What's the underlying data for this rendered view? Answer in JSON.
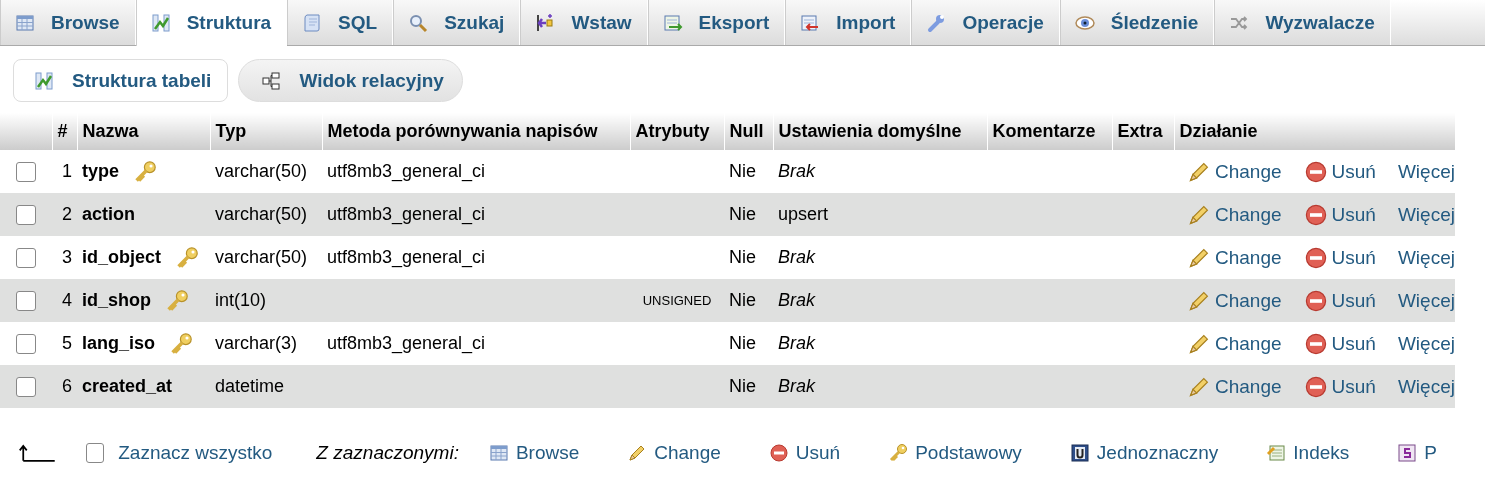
{
  "tabs": [
    {
      "label": "Browse",
      "kind": "table",
      "selected": false
    },
    {
      "label": "Struktura",
      "kind": "structure",
      "selected": true
    },
    {
      "label": "SQL",
      "kind": "scroll",
      "selected": false
    },
    {
      "label": "Szukaj",
      "kind": "search",
      "selected": false
    },
    {
      "label": "Wstaw",
      "kind": "insert",
      "selected": false
    },
    {
      "label": "Eksport",
      "kind": "export",
      "selected": false
    },
    {
      "label": "Import",
      "kind": "import",
      "selected": false
    },
    {
      "label": "Operacje",
      "kind": "wrench",
      "selected": false
    },
    {
      "label": "Śledzenie",
      "kind": "eye",
      "selected": false
    },
    {
      "label": "Wyzwalacze",
      "kind": "shuffle",
      "selected": false
    }
  ],
  "subtabs": [
    {
      "label": "Struktura tabeli",
      "kind": "structure",
      "selected": true
    },
    {
      "label": "Widok relacyjny",
      "kind": "relation",
      "selected": false
    }
  ],
  "table": {
    "columns": [
      "#",
      "Nazwa",
      "Typ",
      "Metoda porównywania napisów",
      "Atrybuty",
      "Null",
      "Ustawienia domyślne",
      "Komentarze",
      "Extra",
      "Działanie"
    ],
    "rows": [
      {
        "checked": false,
        "number": "1",
        "name": "type",
        "indexed": true,
        "type": "varchar(50)",
        "collation": "utf8mb3_general_ci",
        "null": "Nie",
        "default": "Brak",
        "default_is_null": true,
        "actions": [
          "Change",
          "Usuń",
          "Więcej"
        ]
      },
      {
        "checked": false,
        "number": "2",
        "name": "action",
        "indexed": false,
        "type": "varchar(50)",
        "collation": "utf8mb3_general_ci",
        "null": "Nie",
        "default": "upsert",
        "default_is_null": false,
        "actions": [
          "Change",
          "Usuń",
          "Więcej"
        ]
      },
      {
        "checked": false,
        "number": "3",
        "name": "id_object",
        "indexed": true,
        "type": "varchar(50)",
        "collation": "utf8mb3_general_ci",
        "null": "Nie",
        "default": "Brak",
        "default_is_null": true,
        "actions": [
          "Change",
          "Usuń",
          "Więcej"
        ]
      },
      {
        "checked": false,
        "number": "4",
        "name": "id_shop",
        "indexed": true,
        "type": "int(10)",
        "attributes": "UNSIGNED",
        "null": "Nie",
        "default": "Brak",
        "default_is_null": true,
        "actions": [
          "Change",
          "Usuń",
          "Więcej"
        ]
      },
      {
        "checked": false,
        "number": "5",
        "name": "lang_iso",
        "indexed": true,
        "type": "varchar(3)",
        "collation": "utf8mb3_general_ci",
        "null": "Nie",
        "default": "Brak",
        "default_is_null": true,
        "actions": [
          "Change",
          "Usuń",
          "Więcej"
        ]
      },
      {
        "checked": false,
        "number": "6",
        "name": "created_at",
        "indexed": false,
        "type": "datetime",
        "null": "Nie",
        "default": "Brak",
        "default_is_null": true,
        "actions": [
          "Change",
          "Usuń",
          "Więcej"
        ]
      }
    ]
  },
  "footer": {
    "select_all": {
      "label": "Zaznacz wszystko",
      "checked": false
    },
    "with_selected": "Z zaznaczonymi:",
    "actions": [
      {
        "label": "Browse",
        "kind": "table"
      },
      {
        "label": "Change",
        "kind": "pencil"
      },
      {
        "label": "Usuń",
        "kind": "minus"
      },
      {
        "label": "Podstawowy",
        "kind": "key"
      },
      {
        "label": "Jednoznaczny",
        "kind": "unique"
      },
      {
        "label": "Indeks",
        "kind": "index"
      },
      {
        "label": "P",
        "kind": "spatial"
      }
    ]
  }
}
